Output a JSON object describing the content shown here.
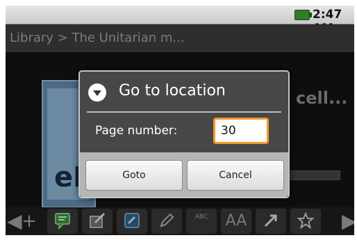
{
  "status_bar": {
    "time": "2:47 AM"
  },
  "title_bar": {
    "breadcrumb": "Library > The Unitarian m..."
  },
  "book": {
    "title_fragment": "cell...",
    "cover_text": "eP"
  },
  "dialog": {
    "title": "Go to location",
    "field_label": "Page number:",
    "page_value": "30",
    "goto_label": "Goto",
    "cancel_label": "Cancel"
  },
  "toolbar": {
    "icons": [
      "arrow-left-icon",
      "plus-icon",
      "comment-icon",
      "edit-note-icon",
      "link-icon",
      "pencil-icon",
      "dictionary-icon",
      "font-size-icon",
      "arrow-diagonal-icon",
      "star-add-icon",
      "arrow-right-icon"
    ],
    "font_size_label": "AA",
    "dictionary_label": "ABC"
  },
  "colors": {
    "accent_focus": "#f59a2a",
    "dialog_bg": "#474747",
    "button_bar": "#b5b5b5"
  }
}
